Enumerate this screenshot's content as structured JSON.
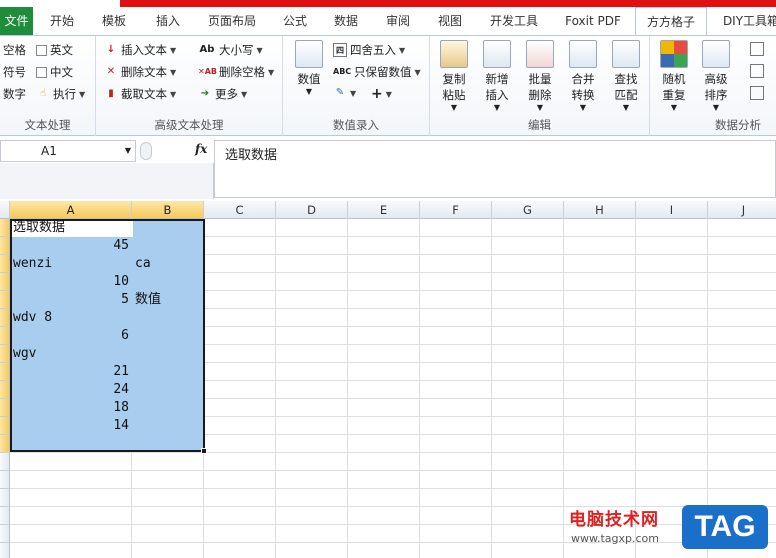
{
  "tabs": [
    "文件",
    "开始",
    "模板",
    "插入",
    "页面布局",
    "公式",
    "数据",
    "审阅",
    "视图",
    "开发工具",
    "Foxit PDF",
    "方方格子",
    "DIY工具箱"
  ],
  "active_tab": "方方格子",
  "ribbon": {
    "text_group": {
      "label": "文本处理",
      "items": [
        "空格",
        "英文",
        "符号",
        "中文",
        "数字",
        "执行"
      ]
    },
    "adv_text_group": {
      "label": "高级文本处理",
      "insert_text": "插入文本",
      "delete_text": "删除文本",
      "extract_text": "截取文本",
      "case": "大小写",
      "delete_space": "删除空格",
      "more": "更多"
    },
    "value_group": {
      "label": "数值录入",
      "value": "数值",
      "round": "四舍五入",
      "keep_value": "只保留数值",
      "plus": "+"
    },
    "edit_group": {
      "label": "编辑",
      "buttons": [
        {
          "l1": "复制",
          "l2": "粘贴"
        },
        {
          "l1": "新增",
          "l2": "插入"
        },
        {
          "l1": "批量",
          "l2": "删除"
        },
        {
          "l1": "合并",
          "l2": "转换"
        },
        {
          "l1": "查找",
          "l2": "匹配"
        }
      ]
    },
    "analysis_group": {
      "label": "数据分析",
      "buttons": [
        {
          "l1": "随机",
          "l2": "重复"
        },
        {
          "l1": "高级",
          "l2": "排序"
        }
      ]
    }
  },
  "formula_bar": {
    "name_box": "A1",
    "fx": "fx",
    "content": "选取数据"
  },
  "columns": [
    "A",
    "B",
    "C",
    "D",
    "E",
    "F",
    "G",
    "H",
    "I",
    "J"
  ],
  "cells": [
    {
      "text": "选取数据",
      "col": "A",
      "type": "text"
    },
    {
      "text": "45",
      "col": "A",
      "type": "num"
    },
    {
      "text": "wenzi",
      "col": "A",
      "type": "text"
    },
    {
      "text": "ca",
      "col": "B",
      "type": "text"
    },
    {
      "text": "10",
      "col": "A",
      "type": "num"
    },
    {
      "text": "5",
      "col": "A",
      "type": "num"
    },
    {
      "text": "数值",
      "col": "B",
      "type": "text"
    },
    {
      "text": "wdv 8",
      "col": "A",
      "type": "text"
    },
    {
      "text": "6",
      "col": "A",
      "type": "num"
    },
    {
      "text": "wgv",
      "col": "A",
      "type": "text"
    },
    {
      "text": "21",
      "col": "A",
      "type": "num"
    },
    {
      "text": "24",
      "col": "A",
      "type": "num"
    },
    {
      "text": "18",
      "col": "A",
      "type": "num"
    },
    {
      "text": "14",
      "col": "A",
      "type": "num"
    }
  ],
  "watermark": {
    "text": "电脑技术网",
    "url": "www.tagxp.com",
    "tag": "TAG"
  },
  "colors": {
    "selection": "#a9cdee",
    "file_tab": "#1e8c3a",
    "title_red": "#e01010",
    "watermark_red": "#e02020",
    "watermark_blue": "#1a6fc9"
  }
}
